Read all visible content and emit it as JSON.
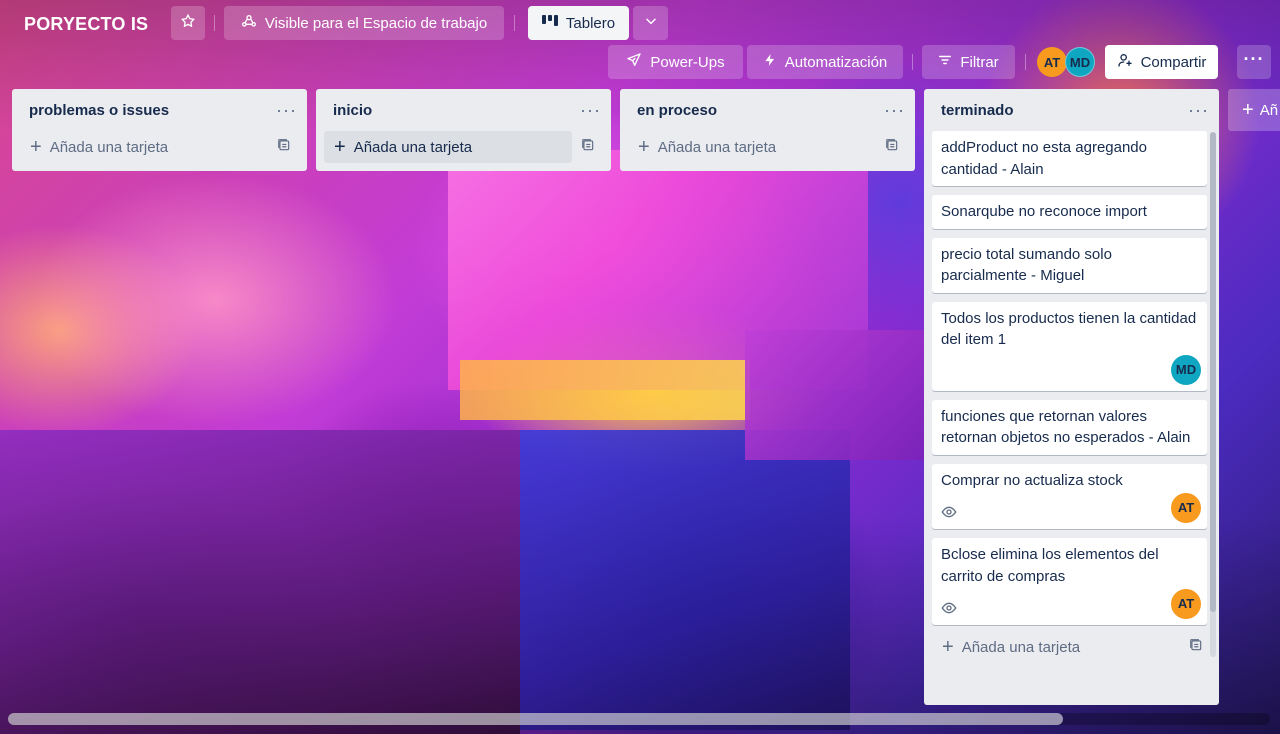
{
  "board": {
    "title": "PORYECTO IS",
    "visibility_label": "Visible para el Espacio de trabajo",
    "view_label": "Tablero",
    "powerups_label": "Power-Ups",
    "automation_label": "Automatización",
    "filter_label": "Filtrar",
    "share_label": "Compartir",
    "members": [
      {
        "initials": "AT",
        "color": "#f79a1d"
      },
      {
        "initials": "MD",
        "color": "#0fa6c1"
      }
    ]
  },
  "lists": [
    {
      "title": "problemas o issues",
      "add_label": "Añada una tarjeta"
    },
    {
      "title": "inicio",
      "add_label": "Añada una tarjeta"
    },
    {
      "title": "en proceso",
      "add_label": "Añada una tarjeta"
    },
    {
      "title": "terminado",
      "add_label": "Añada una tarjeta",
      "cards": [
        {
          "text": "addProduct no esta agregando cantidad - Alain"
        },
        {
          "text": "Sonarqube no reconoce import"
        },
        {
          "text": "precio total sumando solo parcialmente - Miguel"
        },
        {
          "text": "Todos los productos tienen la cantidad del item 1",
          "member": "MD"
        },
        {
          "text": "funciones que retornan valores retornan objetos no esperados - Alain"
        },
        {
          "text": "Comprar no actualiza stock",
          "watching": true,
          "member": "AT"
        },
        {
          "text": "Bclose elimina los elementos del carrito de compras",
          "watching": true,
          "member": "AT"
        }
      ]
    }
  ],
  "add_list_label": "Añ"
}
